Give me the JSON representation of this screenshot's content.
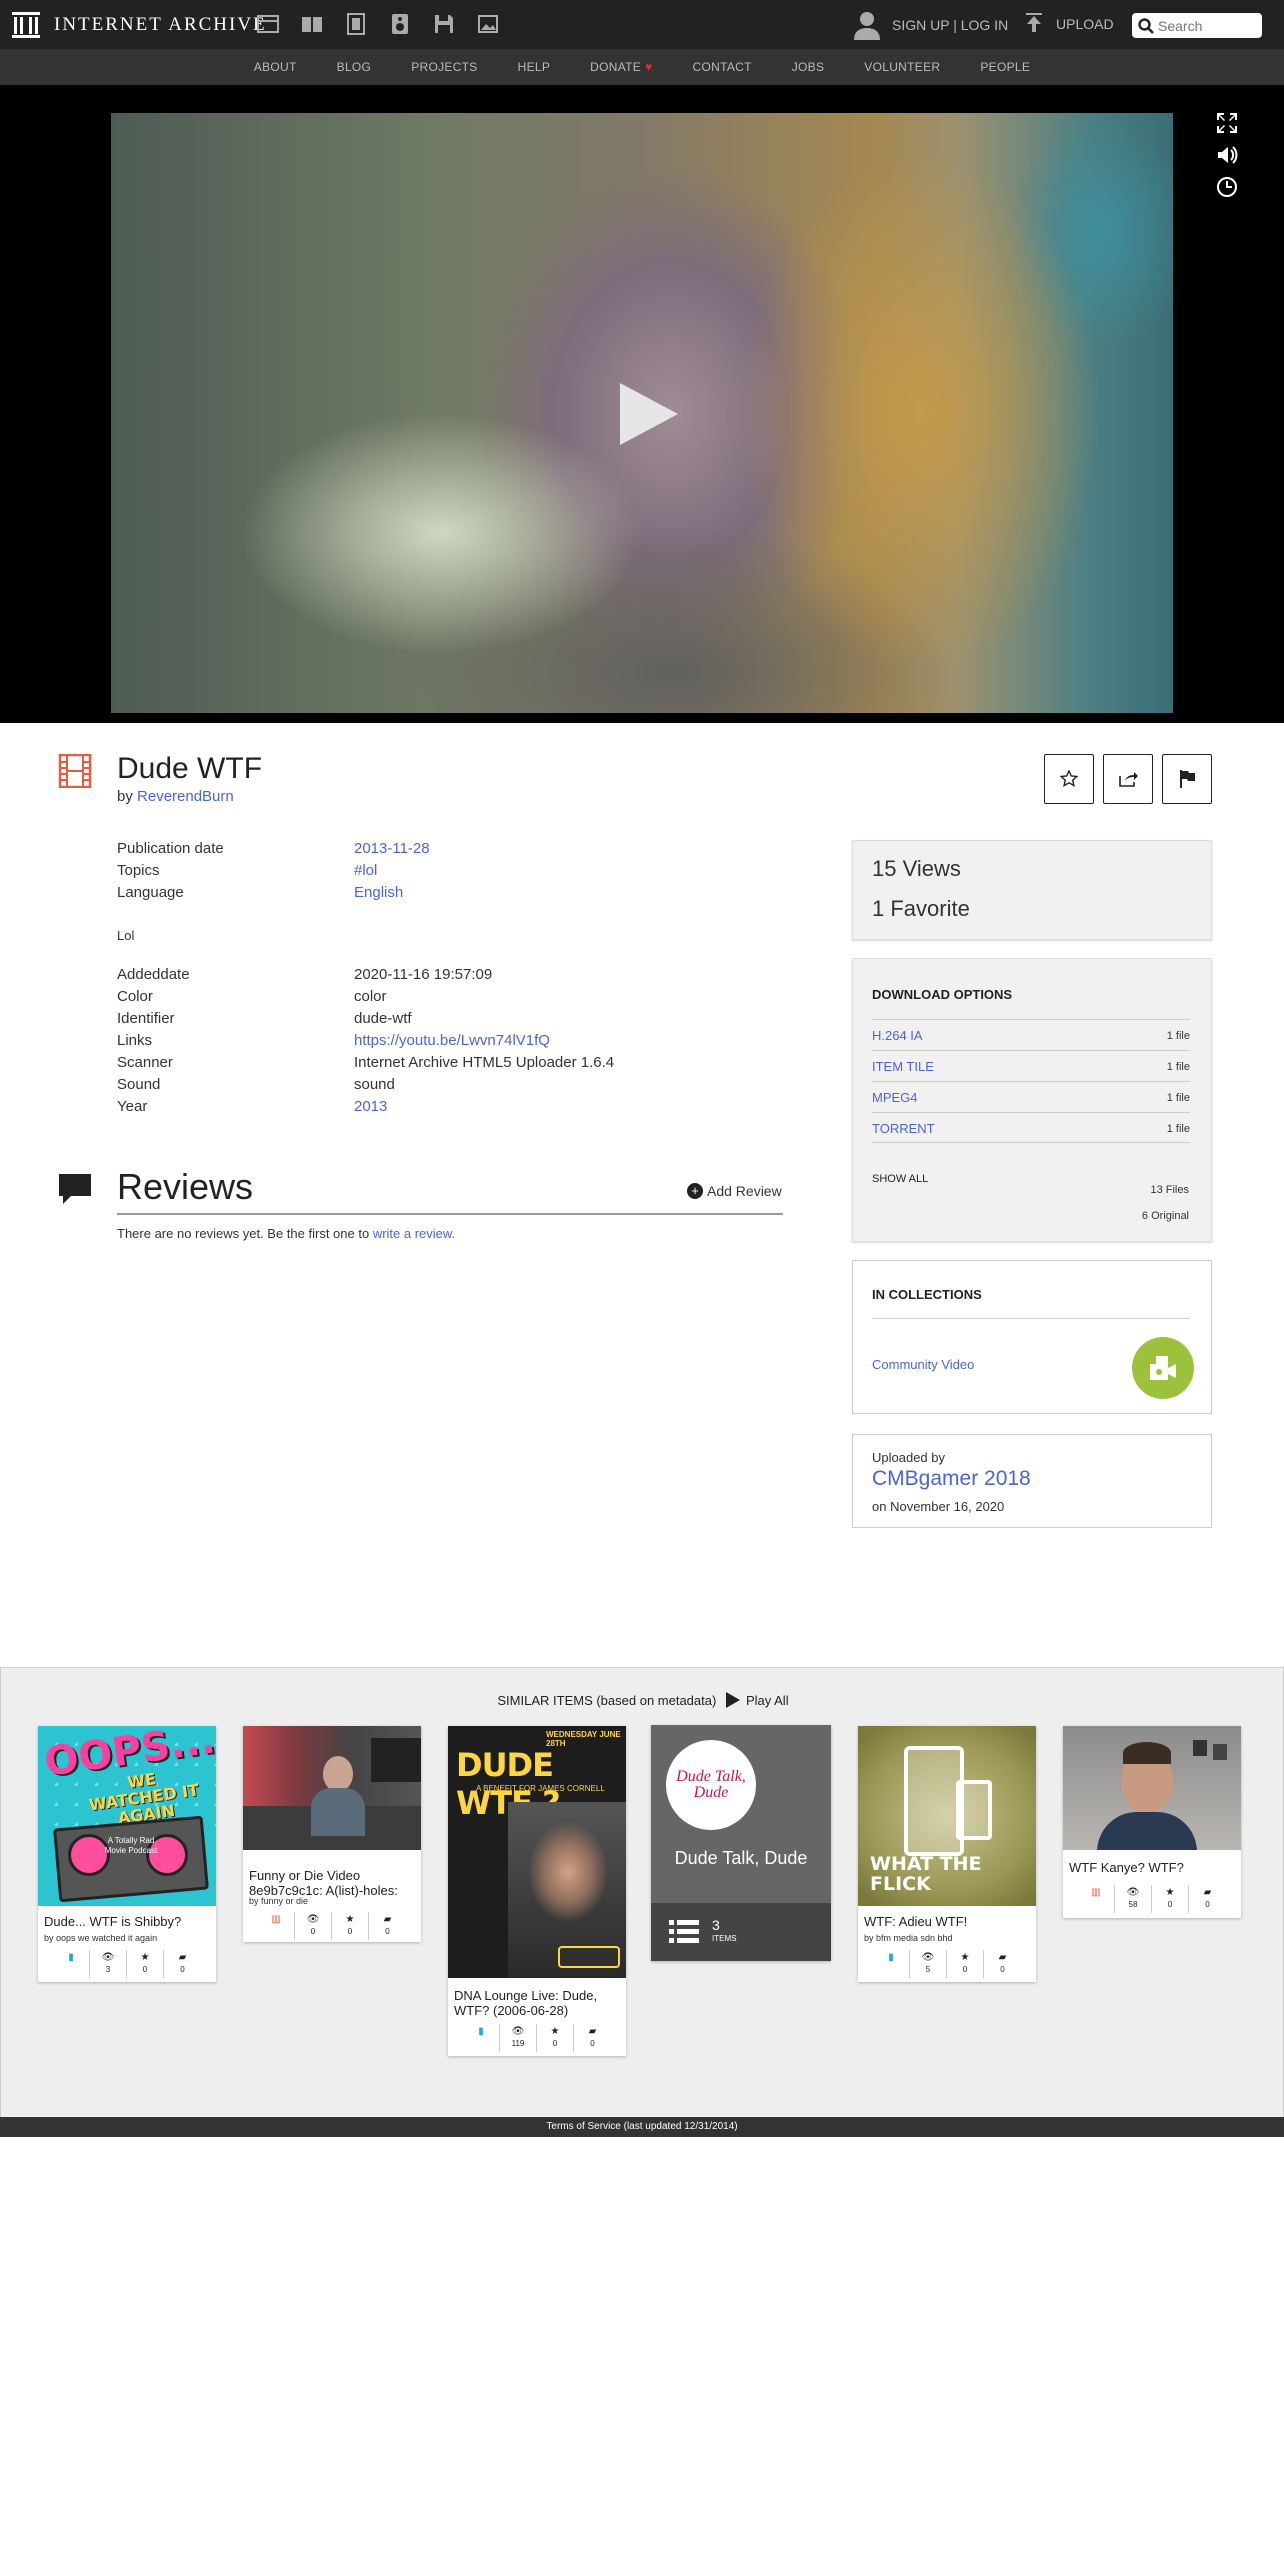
{
  "topbar": {
    "logo_text": "INTERNET ARCHIVE",
    "auth": "SIGN UP | LOG IN",
    "upload": "UPLOAD",
    "search_placeholder": "Search",
    "media_icons": [
      "web-icon",
      "texts-icon",
      "video-icon",
      "audio-icon",
      "software-icon",
      "images-icon"
    ]
  },
  "nav": {
    "items": [
      "ABOUT",
      "BLOG",
      "PROJECTS",
      "HELP",
      "DONATE",
      "CONTACT",
      "JOBS",
      "VOLUNTEER",
      "PEOPLE"
    ]
  },
  "item": {
    "title": "Dude WTF",
    "by_prefix": "by",
    "author": "ReverendBurn",
    "accent_color": "#e75d3f"
  },
  "metadata": {
    "top": [
      {
        "key": "Publication date",
        "value": "2013-11-28",
        "link": true
      },
      {
        "key": "Topics",
        "value": "#lol",
        "link": true
      },
      {
        "key": "Language",
        "value": "English",
        "link": true
      }
    ],
    "description": "Lol",
    "bottom": [
      {
        "key": "Addeddate",
        "value": "2020-11-16 19:57:09",
        "link": false
      },
      {
        "key": "Color",
        "value": "color",
        "link": false
      },
      {
        "key": "Identifier",
        "value": "dude-wtf",
        "link": false
      },
      {
        "key": "Links",
        "value": "https://youtu.be/Lwvn74lV1fQ",
        "link": true
      },
      {
        "key": "Scanner",
        "value": "Internet Archive HTML5 Uploader 1.6.4",
        "link": false
      },
      {
        "key": "Sound",
        "value": "sound",
        "link": false
      },
      {
        "key": "Year",
        "value": "2013",
        "link": true
      }
    ]
  },
  "reviews": {
    "title": "Reviews",
    "add": "Add Review",
    "empty_text": "There are no reviews yet. Be the first one to",
    "empty_link": "write a review."
  },
  "stats": {
    "views": "15 Views",
    "favorites": "1 Favorite"
  },
  "downloads": {
    "title": "DOWNLOAD OPTIONS",
    "rows": [
      {
        "name": "H.264 IA",
        "count": "1 file"
      },
      {
        "name": "ITEM TILE",
        "count": "1 file"
      },
      {
        "name": "MPEG4",
        "count": "1 file"
      },
      {
        "name": "TORRENT",
        "count": "1 file"
      }
    ],
    "show_all": "SHOW ALL",
    "files": "13 Files",
    "original": "6 Original"
  },
  "collections": {
    "title": "IN COLLECTIONS",
    "name": "Community Video",
    "badge_color": "#9cc13b"
  },
  "uploader": {
    "label": "Uploaded by",
    "name": "CMBgamer 2018",
    "date": "on November 16, 2020"
  },
  "similar": {
    "heading": "SIMILAR ITEMS (based on metadata)",
    "play_all": "Play All",
    "tiles": [
      {
        "title": "Dude... WTF is Shibby?",
        "by": "by oops we watched it again",
        "type": "audio-icon",
        "views": "3",
        "favs": "0",
        "reviews": "0",
        "img_text_1": "OOPS...",
        "img_text_2": "WE WATCHED IT AGAIN",
        "img_text_3": "A Totally Rad Movie Podcast"
      },
      {
        "title": "Funny or Die Video 8e9b7c9c1c: A(list)-holes:",
        "by": "by funny or die",
        "type": "film-icon",
        "views": "0",
        "favs": "0",
        "reviews": "0"
      },
      {
        "title": "DNA Lounge Live: Dude, WTF? (2006-06-28)",
        "by": "",
        "type": "audio-icon",
        "views": "119",
        "favs": "0",
        "reviews": "0",
        "img_text_1": "DUDE WTF ?",
        "img_text_2": "A BENEFIT FOR JAMES CORNELL",
        "img_text_3": "WEDNESDAY JUNE 28TH"
      },
      {
        "title": "WTF: Adieu WTF!",
        "by": "by bfm media sdn bhd",
        "type": "audio-icon",
        "views": "5",
        "favs": "0",
        "reviews": "0",
        "img_text_1": "WHAT THE FLICK"
      },
      {
        "title": "WTF Kanye? WTF?",
        "by": "",
        "type": "film-icon",
        "views": "58",
        "favs": "0",
        "reviews": "0"
      }
    ],
    "collection_tile": {
      "name": "Dude Talk, Dude",
      "logo_text": "Dude Talk, Dude",
      "count": "3",
      "label": "ITEMS"
    }
  },
  "footer": "Terms of Service (last updated 12/31/2014)"
}
